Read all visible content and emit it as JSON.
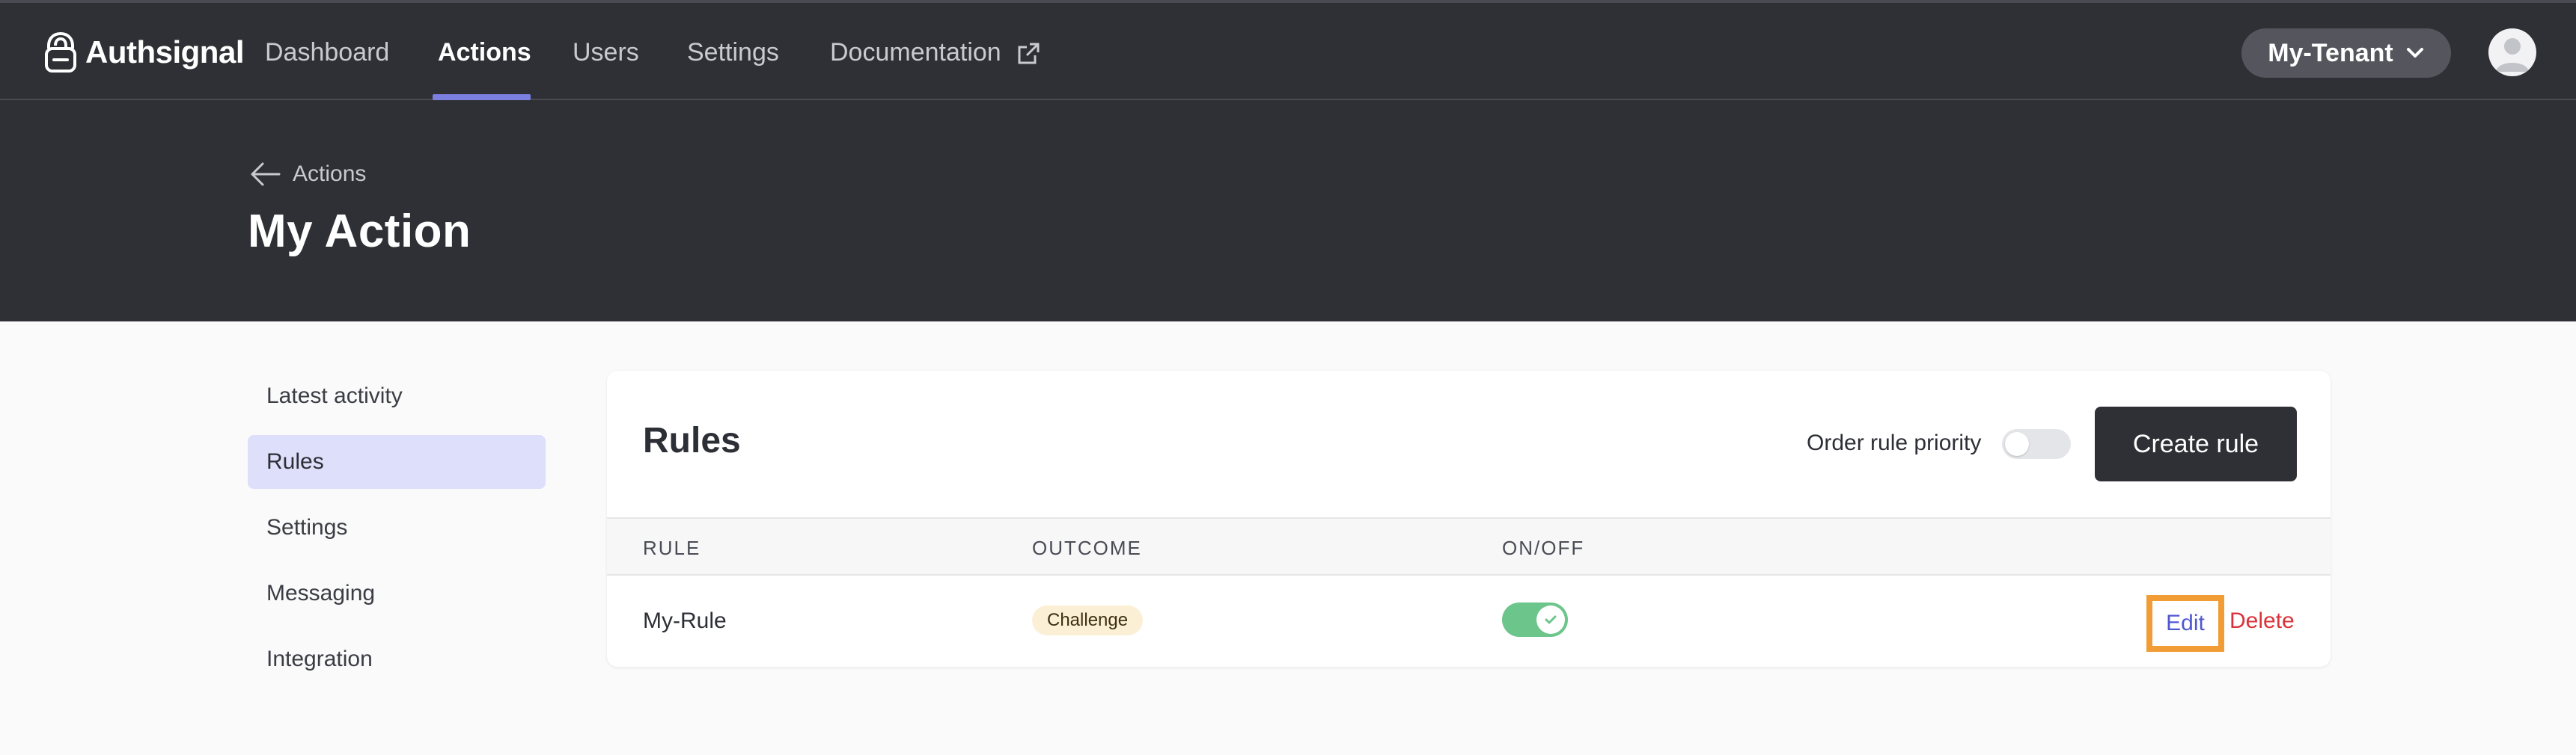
{
  "nav": {
    "brand": "Authsignal",
    "links": [
      {
        "label": "Dashboard",
        "active": false
      },
      {
        "label": "Actions",
        "active": true
      },
      {
        "label": "Users",
        "active": false
      },
      {
        "label": "Settings",
        "active": false
      },
      {
        "label": "Documentation",
        "active": false,
        "external": true
      }
    ],
    "tenant": "My-Tenant",
    "accent_color": "#7b7fe0"
  },
  "header": {
    "back_label": "Actions",
    "title": "My Action"
  },
  "sidebar": {
    "items": [
      {
        "label": "Latest activity",
        "active": false
      },
      {
        "label": "Rules",
        "active": true
      },
      {
        "label": "Settings",
        "active": false
      },
      {
        "label": "Messaging",
        "active": false
      },
      {
        "label": "Integration",
        "active": false
      }
    ]
  },
  "rules": {
    "title": "Rules",
    "order_priority_label": "Order rule priority",
    "order_priority_enabled": false,
    "create_label": "Create rule",
    "columns": [
      "RULE",
      "OUTCOME",
      "ON/OFF"
    ],
    "rows": [
      {
        "name": "My-Rule",
        "outcome": "Challenge",
        "enabled": true,
        "edit_label": "Edit",
        "delete_label": "Delete"
      }
    ]
  },
  "icons": [
    "logo-icon",
    "external-link-icon",
    "chevron-down-icon",
    "avatar-icon",
    "arrow-left-icon",
    "check-icon"
  ],
  "colors": {
    "edit": "#4f57d1",
    "delete": "#d9343b",
    "toggle_on": "#6cc58a",
    "highlight": "#f29c36",
    "badge_bg": "#fbf0d6"
  }
}
